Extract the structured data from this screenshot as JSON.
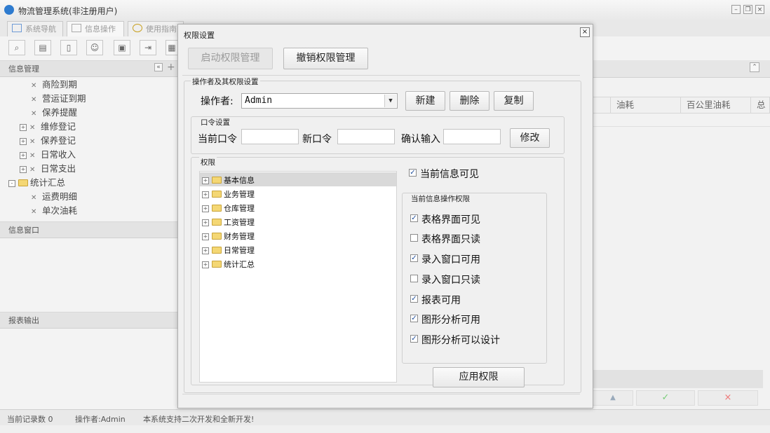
{
  "window": {
    "title": "物流管理系统(非注册用户)"
  },
  "tabs": [
    {
      "label": "系统导航"
    },
    {
      "label": "信息操作"
    },
    {
      "label": "使用指南"
    }
  ],
  "left_panel": {
    "header_info": "信息管理",
    "tree": [
      {
        "label": "商险到期",
        "level": 2
      },
      {
        "label": "营运证到期",
        "level": 2
      },
      {
        "label": "保养提醒",
        "level": 2
      },
      {
        "label": "维修登记",
        "level": 1,
        "expander": "+"
      },
      {
        "label": "保养登记",
        "level": 1,
        "expander": "+"
      },
      {
        "label": "日常收入",
        "level": 1,
        "expander": "+"
      },
      {
        "label": "日常支出",
        "level": 1,
        "expander": "+"
      },
      {
        "label": "统计汇总",
        "level": 0,
        "expander": "-"
      },
      {
        "label": "运费明细",
        "level": 2
      },
      {
        "label": "单次油耗",
        "level": 2
      }
    ],
    "header_window": "信息窗口",
    "header_report": "报表输出"
  },
  "grid": {
    "columns": [
      "油耗",
      "百公里油耗",
      "总"
    ]
  },
  "statusbar": {
    "records": "当前记录数 0",
    "operator": "操作者:Admin",
    "note": "本系统支持二次开发和全新开发!"
  },
  "dialog": {
    "title": "权限设置",
    "close": "×",
    "enable_btn": "启动权限管理",
    "revoke_btn": "撤销权限管理",
    "operator_group": "操作者及其权限设置",
    "operator_label": "操作者:",
    "operator_value": "Admin",
    "new_btn": "新建",
    "delete_btn": "删除",
    "copy_btn": "复制",
    "password_group": "口令设置",
    "current_pw": "当前口令",
    "new_pw": "新口令",
    "confirm_pw": "确认输入",
    "modify_btn": "修改",
    "perm_group": "权限",
    "perm_tree": [
      {
        "label": "基本信息",
        "selected": true
      },
      {
        "label": "业务管理"
      },
      {
        "label": "仓库管理"
      },
      {
        "label": "工资管理"
      },
      {
        "label": "财务管理"
      },
      {
        "label": "日常管理"
      },
      {
        "label": "统计汇总"
      }
    ],
    "visible_check": {
      "label": "当前信息可见",
      "checked": true
    },
    "op_group": "当前信息操作权限",
    "op_checks": [
      {
        "label": "表格界面可见",
        "checked": true
      },
      {
        "label": "表格界面只读",
        "checked": false
      },
      {
        "label": "录入窗口可用",
        "checked": true
      },
      {
        "label": "录入窗口只读",
        "checked": false
      },
      {
        "label": "报表可用",
        "checked": true
      },
      {
        "label": "图形分析可用",
        "checked": true
      },
      {
        "label": "图形分析可以设计",
        "checked": true
      }
    ],
    "apply_btn": "应用权限"
  }
}
